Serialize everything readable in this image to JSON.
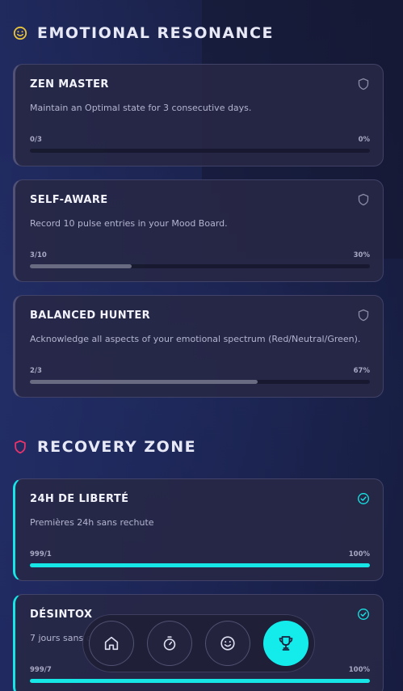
{
  "sections": [
    {
      "title": "EMOTIONAL RESONANCE",
      "icon": "smiley-icon",
      "color": "#e9c43b"
    },
    {
      "title": "RECOVERY ZONE",
      "icon": "shield-icon",
      "color": "#e9336b"
    }
  ],
  "achievements": [
    {
      "title": "ZEN MASTER",
      "description": "Maintain an Optimal state for 3 consecutive days.",
      "progress": "0/3",
      "percent": "0%",
      "fraction": 0,
      "status": "locked",
      "badge": "shield-outline-icon"
    },
    {
      "title": "SELF-AWARE",
      "description": "Record 10 pulse entries in your Mood Board.",
      "progress": "3/10",
      "percent": "30%",
      "fraction": 0.3,
      "status": "locked",
      "badge": "shield-outline-icon"
    },
    {
      "title": "BALANCED HUNTER",
      "description": "Acknowledge all aspects of your emotional spectrum (Red/Neutral/Green).",
      "progress": "2/3",
      "percent": "67%",
      "fraction": 0.67,
      "status": "locked",
      "badge": "shield-outline-icon"
    },
    {
      "title": "24H DE LIBERTÉ",
      "description": "Premières 24h sans rechute",
      "progress": "999/1",
      "percent": "100%",
      "fraction": 1,
      "status": "completed",
      "badge": "check-circle-icon"
    },
    {
      "title": "DÉSINTOX",
      "description": "7 jours sans c",
      "progress": "999/7",
      "percent": "100%",
      "fraction": 1,
      "status": "completed",
      "badge": "check-circle-icon"
    }
  ],
  "navbar": {
    "items": [
      {
        "icon": "home-icon",
        "active": false
      },
      {
        "icon": "stopwatch-icon",
        "active": false
      },
      {
        "icon": "smiley-icon",
        "active": false
      },
      {
        "icon": "trophy-icon",
        "active": true
      }
    ]
  },
  "colors": {
    "accent": "#16e6e6",
    "background": "#1d2654",
    "card": "#28284a"
  }
}
